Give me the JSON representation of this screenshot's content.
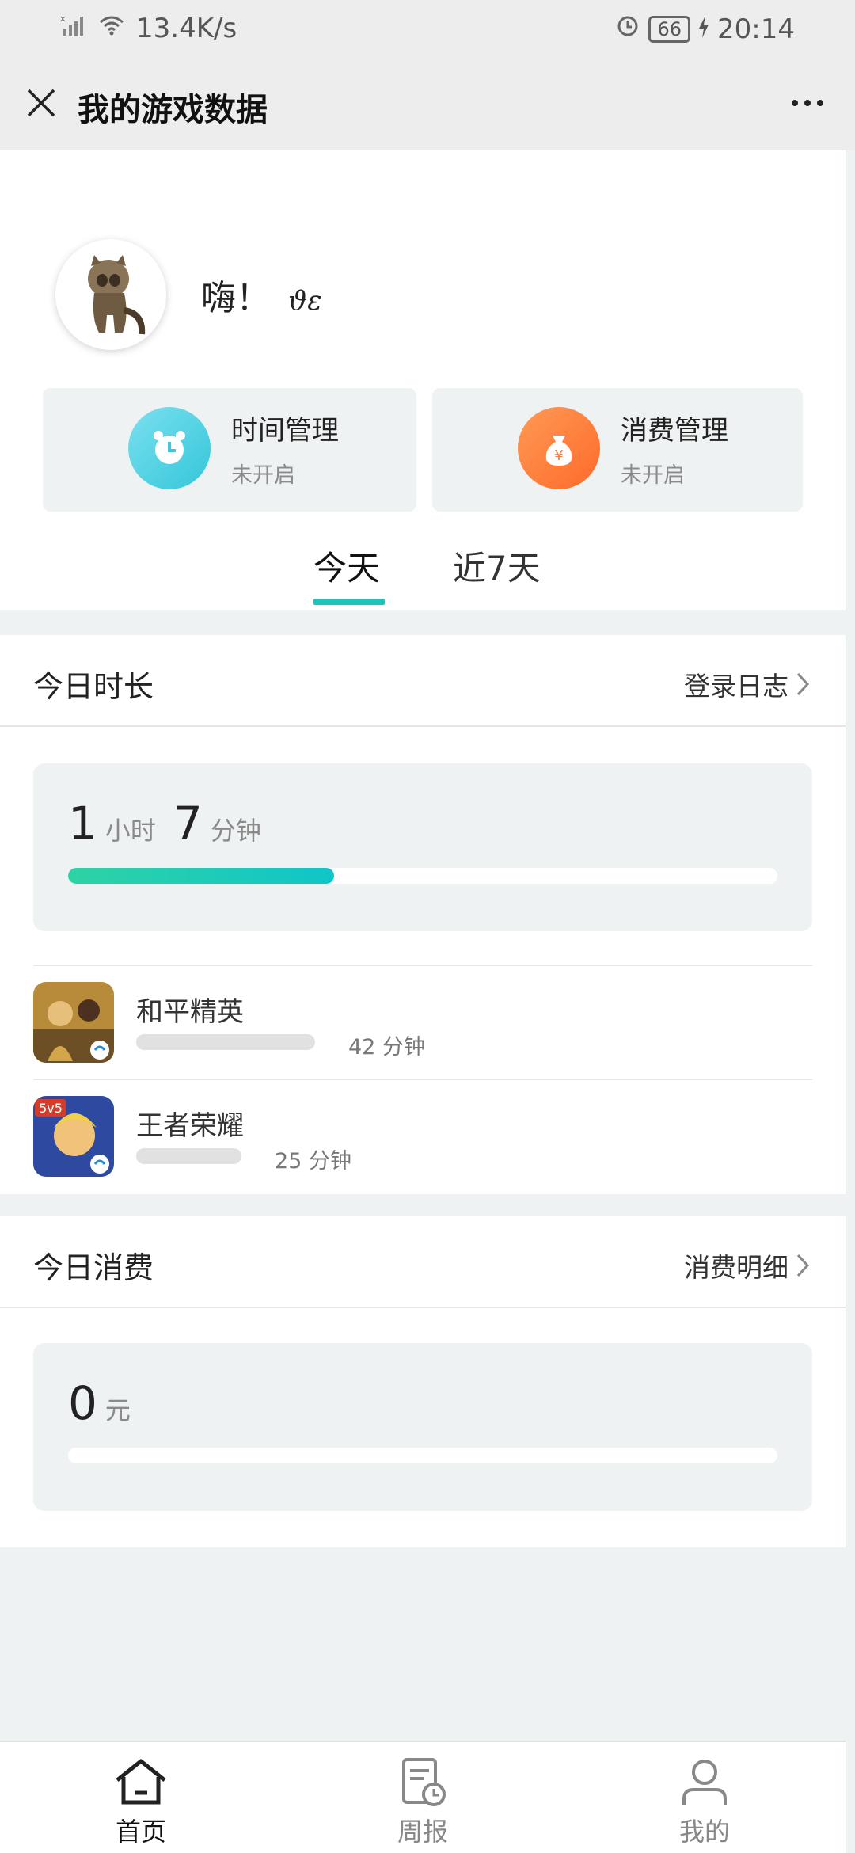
{
  "status_bar": {
    "net_speed": "13.4K/s",
    "battery": "66",
    "time": "20:14"
  },
  "title_bar": {
    "title": "我的游戏数据"
  },
  "profile": {
    "greeting": "嗨！",
    "signature": "ϑɛ"
  },
  "management": [
    {
      "title": "时间管理",
      "status": "未开启",
      "icon": "alarm-clock-icon"
    },
    {
      "title": "消费管理",
      "status": "未开启",
      "icon": "money-bag-icon"
    }
  ],
  "tabs": [
    {
      "label": "今天",
      "active": true
    },
    {
      "label": "近7天",
      "active": false
    }
  ],
  "duration": {
    "title": "今日时长",
    "link": "登录日志",
    "hours": "1",
    "hours_unit": "小时",
    "minutes": "7",
    "minutes_unit": "分钟",
    "progress": 0.375,
    "games": [
      {
        "name": "和平精英",
        "time": "42 分钟",
        "share": 0.63
      },
      {
        "name": "王者荣耀",
        "time": "25 分钟",
        "share": 0.37
      }
    ]
  },
  "spending": {
    "title": "今日消费",
    "link": "消费明细",
    "amount": "0",
    "unit": "元",
    "progress": 0
  },
  "bottom_nav": [
    {
      "label": "首页",
      "active": true
    },
    {
      "label": "周报",
      "active": false
    },
    {
      "label": "我的",
      "active": false
    }
  ],
  "colors": {
    "accent": "#1cc5b8",
    "bar_start": "#2ed3a4",
    "bar_end": "#10c5c8",
    "orange": "#ff6a2a"
  }
}
